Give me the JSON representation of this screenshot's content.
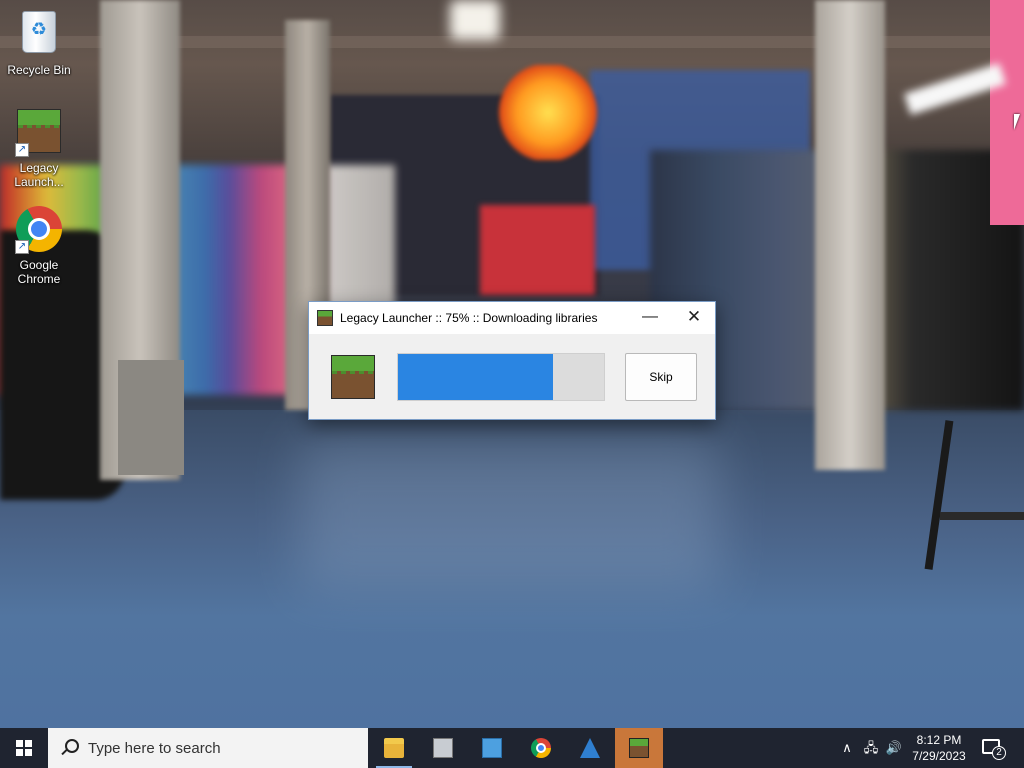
{
  "desktop": {
    "icons": [
      {
        "label": "Recycle Bin",
        "icon": "recycle-bin-icon"
      },
      {
        "label": "Legacy Launch...",
        "icon": "grass-block-icon",
        "shortcut": true
      },
      {
        "label": "Google Chrome",
        "icon": "chrome-icon",
        "shortcut": true
      }
    ]
  },
  "dialog": {
    "title": "Legacy Launcher :: 75% :: Downloading libraries",
    "minimize_glyph": "—",
    "close_glyph": "✕",
    "progress_percent": 75,
    "skip_label": "Skip",
    "accent_color": "#2a85e2"
  },
  "taskbar": {
    "search_placeholder": "Type here to search",
    "apps": [
      {
        "name": "File Explorer",
        "icon": "folder-icon",
        "active": false,
        "running": true
      },
      {
        "name": "This PC",
        "icon": "monitor-icon",
        "active": false,
        "running": false
      },
      {
        "name": "Control Panel",
        "icon": "control-panel-icon",
        "active": false,
        "running": false
      },
      {
        "name": "Google Chrome",
        "icon": "chrome-icon",
        "active": false,
        "running": false
      },
      {
        "name": "Store",
        "icon": "store-icon",
        "active": false,
        "running": false
      },
      {
        "name": "Legacy Launcher",
        "icon": "grass-block-icon",
        "active": true,
        "running": true
      }
    ],
    "tray": {
      "chevron_glyph": "∧",
      "network_glyph": "🖧",
      "volume_glyph": "🔊",
      "time": "8:12 PM",
      "date": "7/29/2023",
      "notification_count": "2"
    }
  }
}
